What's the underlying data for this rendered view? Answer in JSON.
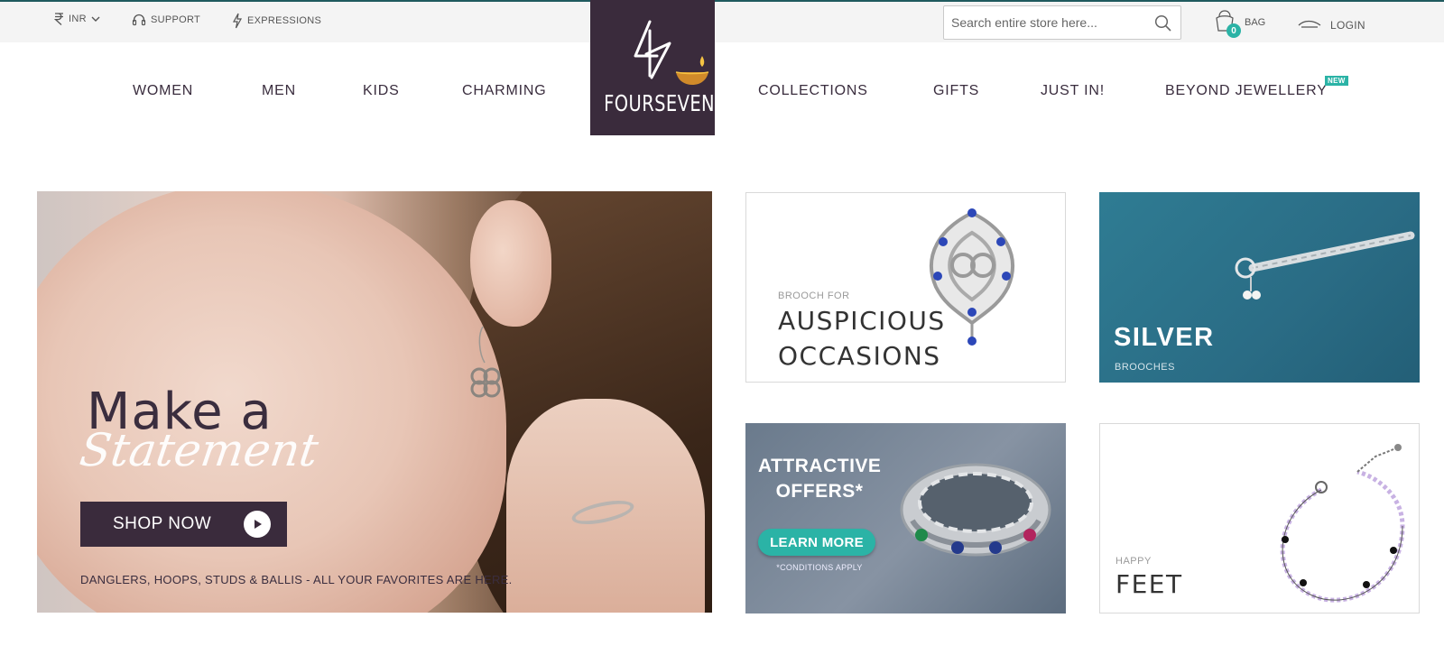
{
  "topbar": {
    "currency": "INR",
    "support": "SUPPORT",
    "expressions": "EXPRESSIONS",
    "search_placeholder": "Search entire store here...",
    "bag_label": "BAG",
    "bag_count": "0",
    "login": "LOGIN"
  },
  "logo": {
    "text": "FOURSEVEN"
  },
  "nav": {
    "women": "WOMEN",
    "men": "MEN",
    "kids": "KIDS",
    "charming": "CHARMING",
    "collections": "COLLECTIONS",
    "gifts": "GIFTS",
    "just_in": "JUST IN!",
    "beyond": "BEYOND JEWELLERY",
    "new_badge": "NEW"
  },
  "hero": {
    "title": "Make a",
    "script": "Statement",
    "cta": "SHOP NOW",
    "subtitle": "DANGLERS, HOOPS, STUDS & BALLIS - ALL YOUR FAVORITES ARE HERE."
  },
  "tiles": {
    "auspicious": {
      "kicker": "BROOCH FOR",
      "title_line1": "AUSPICIOUS",
      "title_line2": "OCCASIONS"
    },
    "silver": {
      "title": "SILVER",
      "subtitle": "BROOCHES"
    },
    "offers": {
      "title_line1": "ATTRACTIVE",
      "title_line2": "OFFERS*",
      "cta": "LEARN MORE",
      "note": "*CONDITIONS APPLY"
    },
    "feet": {
      "kicker": "HAPPY",
      "title": "FEET"
    }
  },
  "colors": {
    "brand": "#3a2b3c",
    "accent": "#2bb3a6",
    "topbar_bg": "#f4f4f4"
  },
  "icons": [
    "rupee-icon",
    "chevron-down-icon",
    "headset-icon",
    "lightning-icon",
    "search-icon",
    "bag-icon",
    "login-icon",
    "play-icon",
    "diya-icon"
  ]
}
